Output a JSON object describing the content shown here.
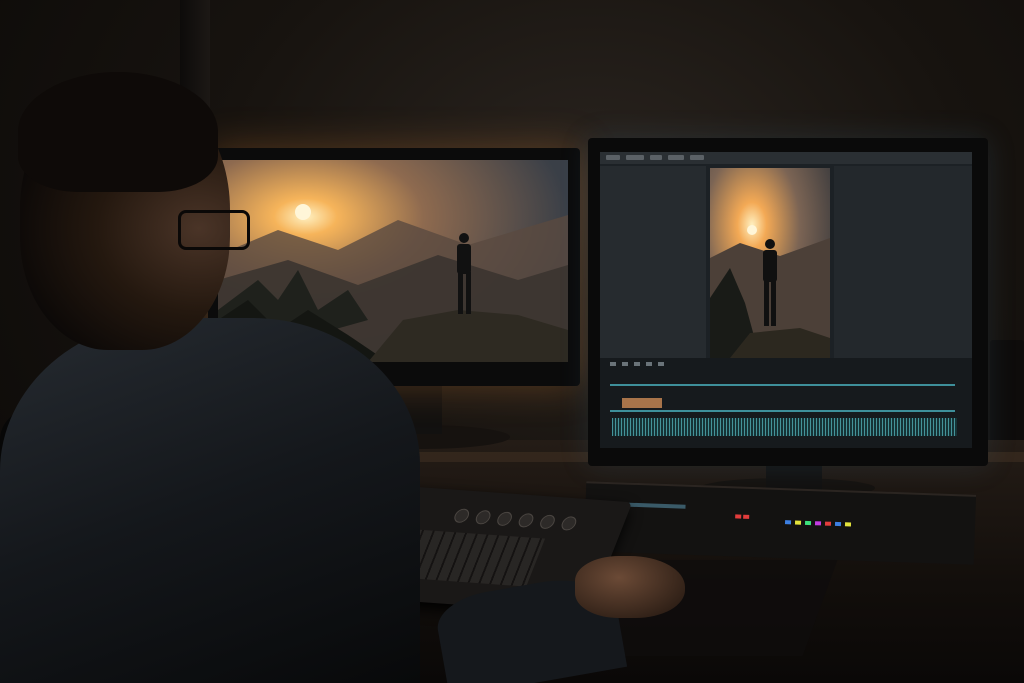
{
  "scene": {
    "description_colors": {
      "accent_warm": "#f2b15a",
      "screen_glow": "#ff9a3c",
      "ui_panel": "#262b2f",
      "timeline_teal": "#4fb1b8"
    },
    "left_monitor": {
      "content": "landscape-sunset-silhouette"
    },
    "right_monitor": {
      "content": "video-editor"
    },
    "rack_leds": [
      "#e23c3c",
      "#3c7fe2",
      "#e2e23c",
      "#3ce27c",
      "#c23ce2"
    ]
  }
}
